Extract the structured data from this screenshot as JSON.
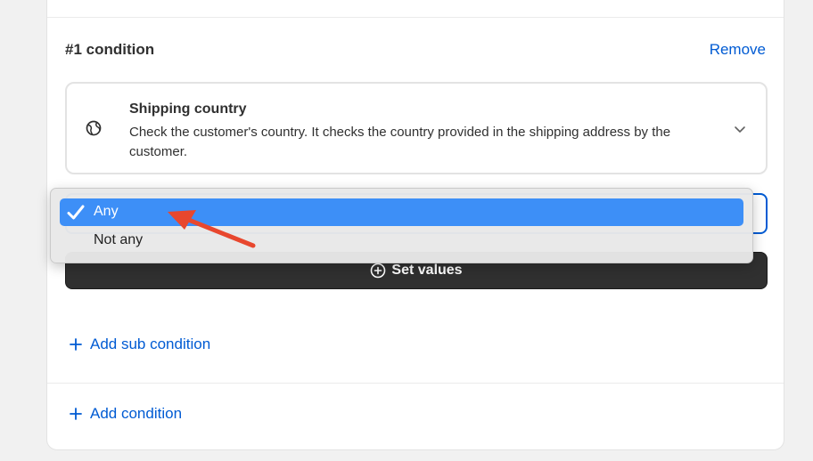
{
  "condition": {
    "title": "#1 condition",
    "remove_label": "Remove"
  },
  "field": {
    "icon": "globe-icon",
    "title": "Shipping country",
    "description": "Check the customer's country. It checks the country provided in the shipping address by the customer."
  },
  "dropdown": {
    "options": [
      {
        "label": "Any",
        "selected": true
      },
      {
        "label": "Not any",
        "selected": false
      }
    ]
  },
  "set_values_label": "Set values",
  "add_sub_condition_label": "Add sub condition",
  "add_condition_label": "Add condition",
  "colors": {
    "link": "#005bd3",
    "selected_option": "#3d8ff7",
    "annotation_arrow": "#e8472e",
    "button_dark": "#303030"
  }
}
